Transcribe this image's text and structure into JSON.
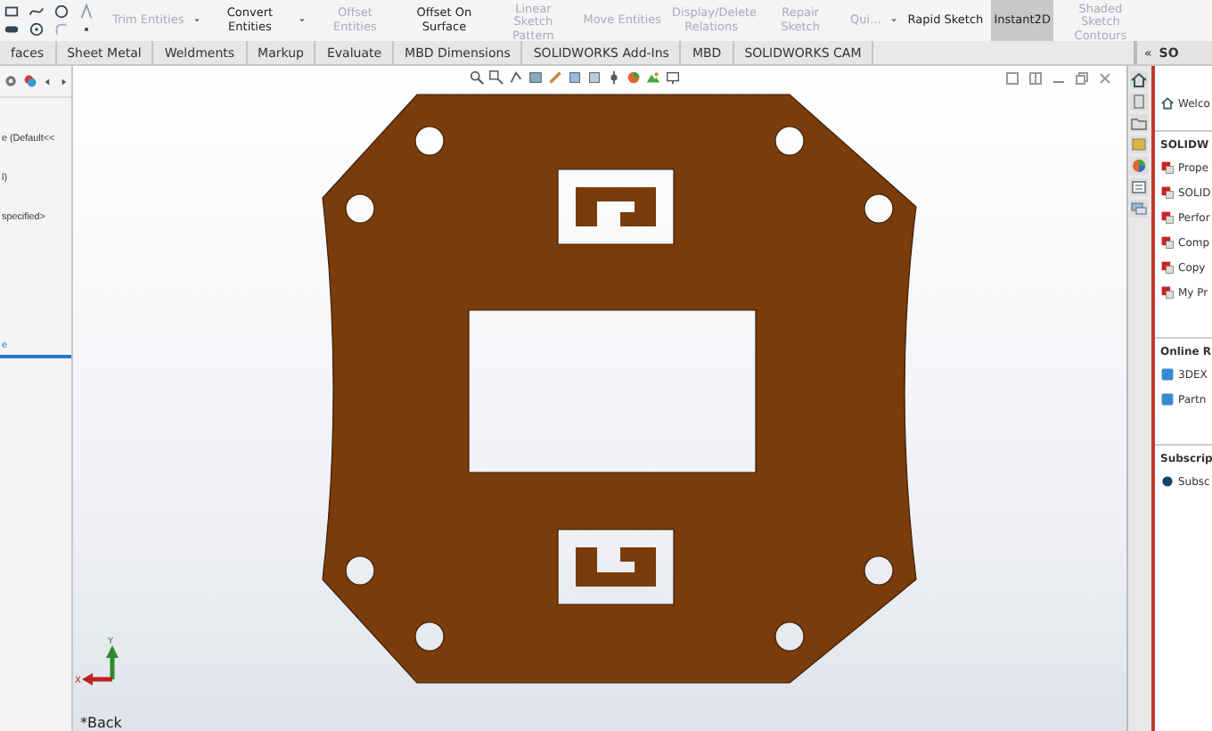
{
  "ribbon": {
    "items": [
      {
        "label": "Trim Entities",
        "disabled": true,
        "selected": false,
        "caret": true
      },
      {
        "label": "Convert Entities",
        "disabled": false,
        "selected": false,
        "caret": true
      },
      {
        "label": "Offset Entities",
        "disabled": true,
        "selected": false,
        "caret": false
      },
      {
        "label": "Offset On Surface",
        "disabled": false,
        "selected": false,
        "caret": false
      },
      {
        "label": "Linear Sketch Pattern",
        "disabled": true,
        "selected": false,
        "caret": false
      },
      {
        "label": "Move Entities",
        "disabled": true,
        "selected": false,
        "caret": false
      },
      {
        "label": "Display/Delete Relations",
        "disabled": true,
        "selected": false,
        "caret": false
      },
      {
        "label": "Repair Sketch",
        "disabled": true,
        "selected": false,
        "caret": false
      },
      {
        "label": "Qui...",
        "disabled": true,
        "selected": false,
        "caret": true
      },
      {
        "label": "Rapid Sketch",
        "disabled": false,
        "selected": false,
        "caret": false
      },
      {
        "label": "Instant2D",
        "disabled": false,
        "selected": true,
        "caret": false
      },
      {
        "label": "Shaded Sketch Contours",
        "disabled": true,
        "selected": false,
        "caret": false
      }
    ]
  },
  "tabs": [
    {
      "label": "faces"
    },
    {
      "label": "Sheet Metal"
    },
    {
      "label": "Weldments"
    },
    {
      "label": "Markup"
    },
    {
      "label": "Evaluate"
    },
    {
      "label": "MBD Dimensions"
    },
    {
      "label": "SOLIDWORKS Add-Ins"
    },
    {
      "label": "MBD"
    },
    {
      "label": "SOLIDWORKS CAM"
    }
  ],
  "feature_tree": {
    "rows": [
      {
        "text": "e  (Default<<",
        "selected": false
      },
      {
        "text": "l)",
        "selected": false
      },
      {
        "text": "specified>",
        "selected": false
      },
      {
        "text": "e",
        "selected": true
      }
    ]
  },
  "viewport": {
    "view_label": "*Back",
    "triad": {
      "x": "X",
      "y": "Y"
    }
  },
  "task_pane": {
    "collapse": "«",
    "title": "SO",
    "welcome": "Welco",
    "sections": [
      {
        "title": "SOLIDW",
        "items": [
          "Prope",
          "SOLID",
          "Perfor",
          "Comp",
          "Copy",
          "My Pr"
        ]
      },
      {
        "title": "Online R",
        "items": [
          "3DEX",
          "Partn"
        ]
      },
      {
        "title": "Subscrip",
        "items": [
          "Subsc"
        ]
      }
    ]
  }
}
